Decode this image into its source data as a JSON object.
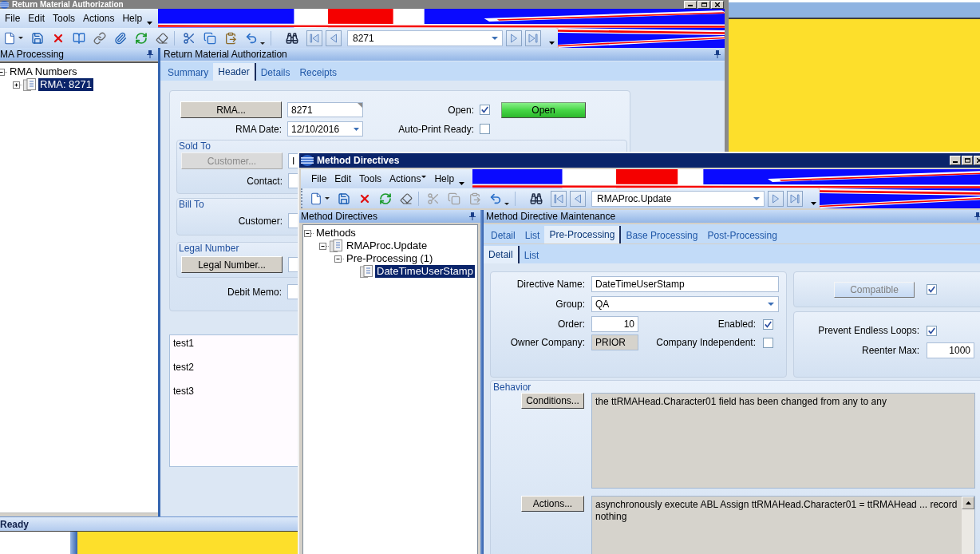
{
  "rma_window": {
    "title": "Return Material Authorization",
    "active": false,
    "menu": [
      {
        "label": "File",
        "dropdown": false
      },
      {
        "label": "Edit",
        "dropdown": false
      },
      {
        "label": "Tools",
        "dropdown": false
      },
      {
        "label": "Actions",
        "dropdown": false
      },
      {
        "label": "Help",
        "dropdown": false
      }
    ],
    "tools": [
      {
        "kind": "new",
        "disabled": false
      },
      {
        "kind": "save",
        "disabled": false
      },
      {
        "kind": "delete",
        "disabled": false
      },
      {
        "kind": "book",
        "disabled": false
      },
      {
        "kind": "link",
        "disabled": false
      },
      {
        "kind": "attach",
        "disabled": false
      },
      {
        "kind": "refresh",
        "disabled": false
      },
      {
        "kind": "clear",
        "disabled": false
      },
      {
        "kind": "separator"
      },
      {
        "kind": "cut",
        "disabled": false
      },
      {
        "kind": "copy",
        "disabled": false
      },
      {
        "kind": "paste",
        "disabled": false
      },
      {
        "kind": "undo",
        "disabled": false
      },
      {
        "kind": "separator"
      },
      {
        "kind": "search",
        "disabled": false
      },
      {
        "kind": "first",
        "disabled": false
      },
      {
        "kind": "prev",
        "disabled": false
      },
      {
        "kind": "combo",
        "value": "8271"
      },
      {
        "kind": "next",
        "disabled": false
      },
      {
        "kind": "last",
        "disabled": false
      }
    ],
    "tree_panel": {
      "title": "MA Processing",
      "tree": [
        {
          "label": "RMA Numbers",
          "kind": "group",
          "expanded": true,
          "selected": false,
          "children": [
            {
              "label": "RMA: 8271",
              "kind": "record",
              "expanded": false,
              "selected": true
            }
          ]
        }
      ]
    },
    "main_panel": {
      "title": "Return Material Authorization",
      "tabs": [
        {
          "label": "Summary",
          "selected": false
        },
        {
          "label": "Header",
          "selected": true
        },
        {
          "label": "Details",
          "selected": false
        },
        {
          "label": "Receipts",
          "selected": false
        }
      ],
      "form": {
        "rma_button": {
          "label": "RMA...",
          "disabled": false
        },
        "rma_number": "8271",
        "open": {
          "label": "Open:",
          "checked": true
        },
        "status": "Open",
        "rma_date": {
          "label": "RMA Date:",
          "value": "12/10/2016"
        },
        "auto_print": {
          "label": "Auto-Print Ready:",
          "checked": false
        },
        "sold_to": {
          "title": "Sold To",
          "customer_button": {
            "label": "Customer...",
            "disabled": true
          },
          "customer_value": "I",
          "contact_label": "Contact:"
        },
        "bill_to": {
          "title": "Bill To",
          "customer_label": "Customer:"
        },
        "legal_number": {
          "title": "Legal Number",
          "button": {
            "label": "Legal Number...",
            "disabled": false
          }
        },
        "debit_memo_label": "Debit Memo:"
      },
      "memo_lines": [
        "test1",
        "test2",
        "test3"
      ]
    },
    "status_bar": "Ready"
  },
  "directives_window": {
    "title": "Method Directives",
    "active": true,
    "menu": [
      {
        "label": "File",
        "dropdown": false
      },
      {
        "label": "Edit",
        "dropdown": false
      },
      {
        "label": "Tools",
        "dropdown": false
      },
      {
        "label": "Actions",
        "dropdown": true
      },
      {
        "label": "Help",
        "dropdown": false
      }
    ],
    "tools": [
      {
        "kind": "new",
        "disabled": false
      },
      {
        "kind": "save",
        "disabled": false
      },
      {
        "kind": "delete",
        "disabled": false
      },
      {
        "kind": "refresh",
        "disabled": false
      },
      {
        "kind": "clear",
        "disabled": false
      },
      {
        "kind": "separator"
      },
      {
        "kind": "cut",
        "disabled": true
      },
      {
        "kind": "copy",
        "disabled": true
      },
      {
        "kind": "paste",
        "disabled": true
      },
      {
        "kind": "undo",
        "disabled": false
      },
      {
        "kind": "separator"
      },
      {
        "kind": "search",
        "disabled": false
      },
      {
        "kind": "first",
        "disabled": false
      },
      {
        "kind": "prev",
        "disabled": false
      },
      {
        "kind": "combo",
        "value": "RMAProc.Update"
      },
      {
        "kind": "next",
        "disabled": false
      },
      {
        "kind": "last",
        "disabled": false
      }
    ],
    "tree_panel": {
      "title": "Method Directives",
      "tree": [
        {
          "label": "Methods",
          "kind": "group",
          "expanded": true,
          "selected": false,
          "children": [
            {
              "label": "RMAProc.Update",
              "kind": "record",
              "expanded": true,
              "selected": false,
              "children": [
                {
                  "label": "Pre-Processing (1)",
                  "kind": "group",
                  "expanded": true,
                  "selected": false,
                  "children": [
                    {
                      "label": "DateTimeUserStamp",
                      "kind": "record",
                      "selected": true
                    }
                  ]
                }
              ]
            }
          ]
        }
      ]
    },
    "main_panel": {
      "title": "Method Directive Maintenance",
      "tabs": [
        {
          "label": "Detail",
          "selected": false
        },
        {
          "label": "List",
          "selected": false
        },
        {
          "label": "Pre-Processing",
          "selected": true
        },
        {
          "label": "Base Processing",
          "selected": false
        },
        {
          "label": "Post-Processing",
          "selected": false
        }
      ],
      "subtabs": [
        {
          "label": "Detail",
          "selected": true
        },
        {
          "label": "List",
          "selected": false
        }
      ],
      "form": {
        "directive_name": {
          "label": "Directive Name:",
          "value": "DateTimeUserStamp"
        },
        "group": {
          "label": "Group:",
          "value": "QA"
        },
        "order": {
          "label": "Order:",
          "value": "10"
        },
        "enabled": {
          "label": "Enabled:",
          "checked": true
        },
        "owner_company": {
          "label": "Owner Company:",
          "value": "PRIOR"
        },
        "company_independent": {
          "label": "Company Independent:",
          "checked": false
        },
        "compatible": {
          "label": "Compatible",
          "disabled": true,
          "checked": true
        },
        "prevent_endless_loops": {
          "label": "Prevent Endless Loops:",
          "checked": true
        },
        "reenter_max": {
          "label": "Reenter Max:",
          "value": "1000"
        },
        "behavior": {
          "title": "Behavior",
          "conditions": {
            "button": "Conditions...",
            "text": "the ttRMAHead.Character01 field has been changed from any to any"
          },
          "actions": {
            "button": "Actions...",
            "text": "asynchronously execute ABL Assign ttRMAHead.Character01 = ttRMAHead ... record nothing"
          }
        }
      }
    }
  }
}
